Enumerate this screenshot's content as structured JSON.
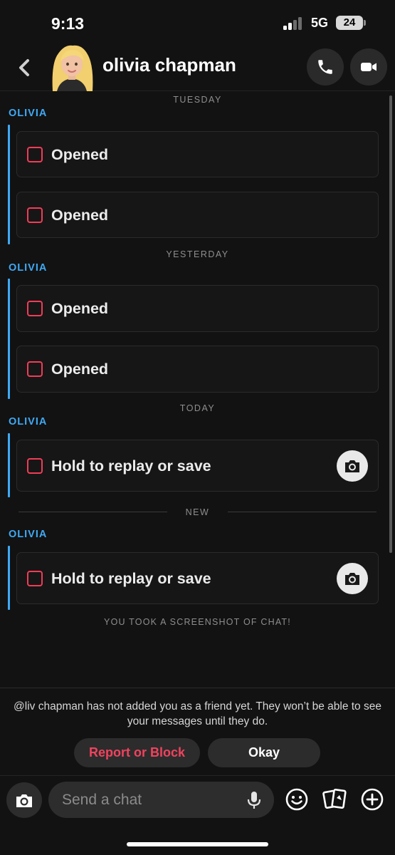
{
  "status_bar": {
    "time": "9:13",
    "network": "5G",
    "battery": "24"
  },
  "header": {
    "contact_name": "olivia chapman",
    "back_icon": "chevron-left-icon",
    "avatar": "bitmoji-avatar",
    "call_icon": "phone-icon",
    "video_icon": "video-camera-icon"
  },
  "chat": {
    "sections": [
      {
        "day": "TUESDAY",
        "sender": "OLIVIA",
        "snaps": [
          "Opened",
          "Opened"
        ]
      },
      {
        "day": "YESTERDAY",
        "sender": "OLIVIA",
        "snaps": [
          "Opened",
          "Opened"
        ]
      },
      {
        "day": "TODAY",
        "sender": "OLIVIA",
        "snaps": [
          "Hold to replay or save"
        ]
      },
      {
        "day": "NEW",
        "sender": "OLIVIA",
        "snaps": [
          "Hold to replay or save"
        ]
      }
    ],
    "screenshot_notice": "YOU TOOK A SCREENSHOT OF CHAT!"
  },
  "friend_notice": {
    "text": "@liv chapman has not added you as a friend yet. They won’t be able to see your messages until they do.",
    "report_label": "Report or Block",
    "okay_label": "Okay"
  },
  "composer": {
    "placeholder": "Send a chat",
    "camera_icon": "camera-icon",
    "mic_icon": "microphone-icon",
    "emoji_icon": "smiley-icon",
    "cards_icon": "cards-icon",
    "plus_icon": "plus-circle-icon"
  },
  "colors": {
    "background": "#121212",
    "accent_blue": "#3fa9f5",
    "snap_red": "#f23c57",
    "report_red": "#f0435e"
  }
}
